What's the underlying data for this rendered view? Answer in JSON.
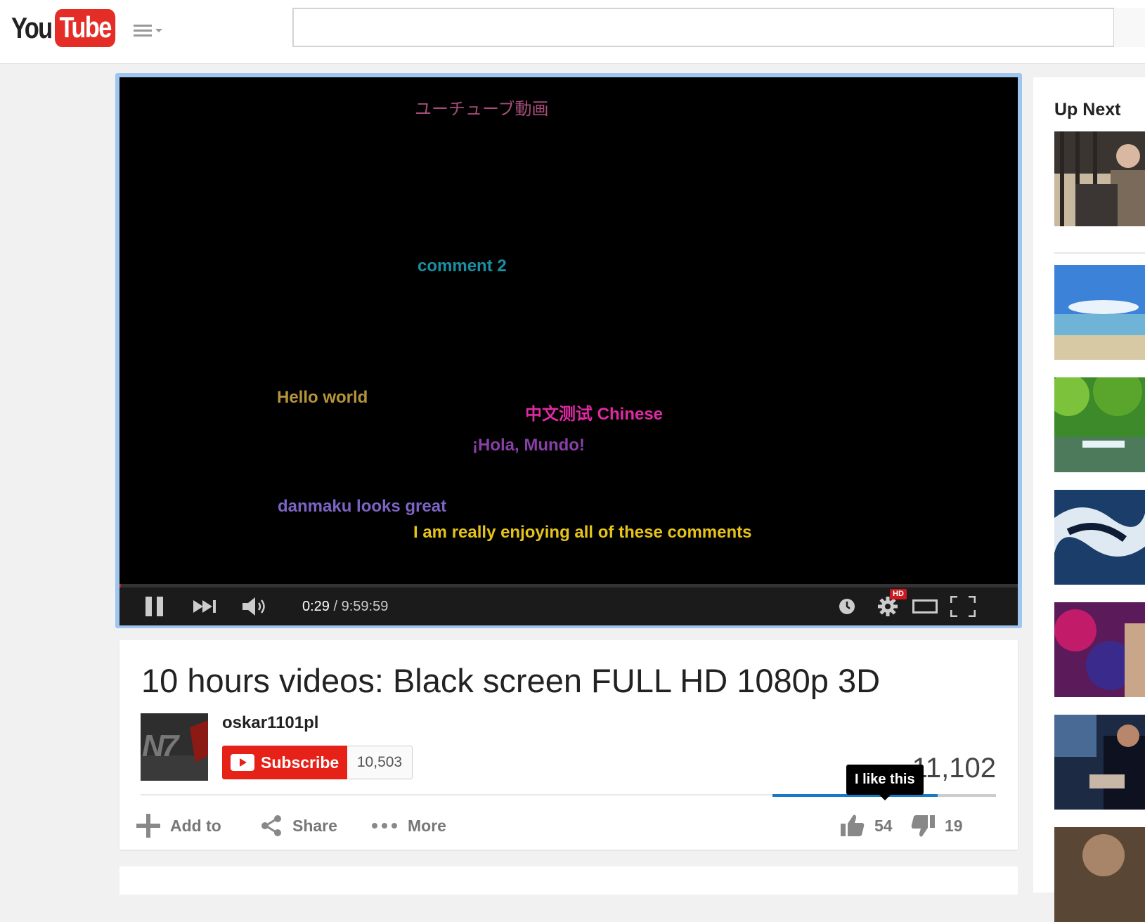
{
  "header": {
    "logo_you": "You",
    "logo_tube": "Tube",
    "search_placeholder": ""
  },
  "player": {
    "danmaku": [
      {
        "text": "ユーチューブ動画",
        "color": "#a64d79"
      },
      {
        "text": "comment 2",
        "color": "#1a8fa3"
      },
      {
        "text": "Hello world",
        "color": "#b5953a"
      },
      {
        "text": "中文测试 Chinese",
        "color": "#e02aa3"
      },
      {
        "text": "¡Hola, Mundo!",
        "color": "#8a3fa8"
      },
      {
        "text": "danmaku looks great",
        "color": "#7c64c4"
      },
      {
        "text": "I am really enjoying all of these comments",
        "color": "#e6c31a"
      }
    ],
    "current_time": "0:29",
    "duration": "9:59:59",
    "time_separator": " / ",
    "progress_fraction": 0.0008,
    "hd_badge": "HD",
    "icons": [
      "pause-icon",
      "next-icon",
      "volume-icon",
      "watch-later-icon",
      "settings-icon",
      "theater-mode-icon",
      "fullscreen-icon"
    ]
  },
  "video": {
    "title": "10 hours videos: Black screen FULL HD 1080p 3D",
    "channel": "oskar1101pl",
    "avatar_text": "N7",
    "subscribe_label": "Subscribe",
    "subscriber_count": "10,503",
    "views": "11,102",
    "like_tooltip": "I like this",
    "likes": "54",
    "dislikes": "19",
    "like_fraction": 0.74,
    "actions": {
      "add_to": "Add to",
      "share": "Share",
      "more": "More"
    }
  },
  "sidebar": {
    "heading": "Up Next"
  },
  "colors": {
    "brand_red": "#e52d27",
    "subscribe_red": "#e62117",
    "like_blue": "#167ac6",
    "player_focus_border": "#9ec6ef"
  }
}
